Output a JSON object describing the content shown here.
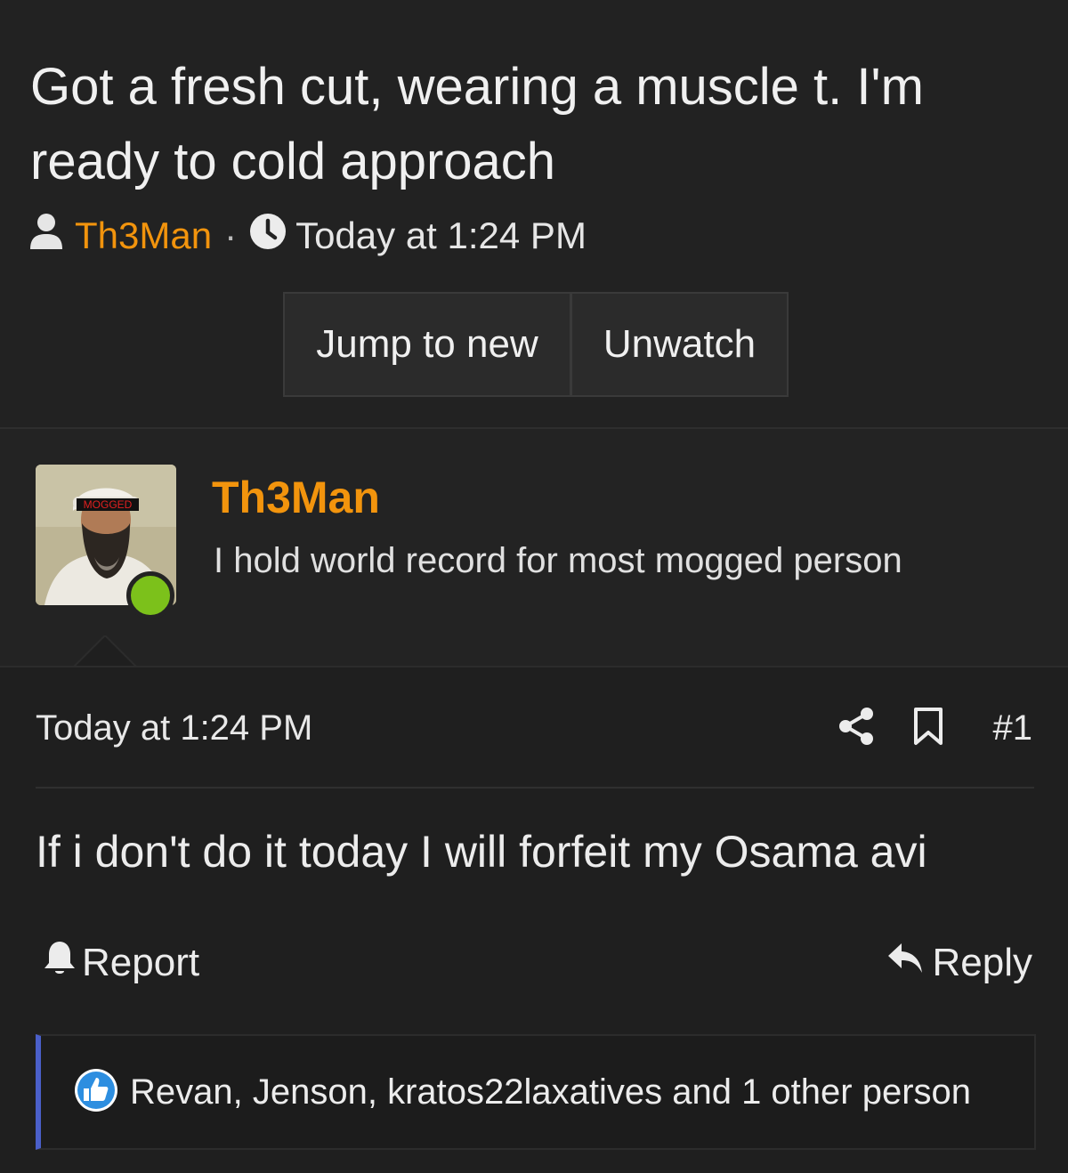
{
  "thread": {
    "title": "Got a fresh cut, wearing a muscle t. I'm ready to cold approach",
    "author": "Th3Man",
    "separator": "·",
    "time": "Today at 1:24 PM"
  },
  "buttons": {
    "jump_to_new": "Jump to new",
    "unwatch": "Unwatch"
  },
  "user": {
    "name": "Th3Man",
    "title": "I hold world record for most mogged person",
    "avatar_badge": "MOGGED",
    "status_color": "#7cc11b"
  },
  "post": {
    "date": "Today at 1:24 PM",
    "number": "#1",
    "body": "If i don't do it today I will forfeit my Osama avi",
    "report_label": "Report",
    "reply_label": "Reply"
  },
  "reactions": {
    "text": "Revan, Jenson, kratos22laxatives and 1 other person"
  },
  "colors": {
    "accent": "#f2940d",
    "background": "#1f1f1f",
    "reaction_border": "#4a5fc9"
  }
}
